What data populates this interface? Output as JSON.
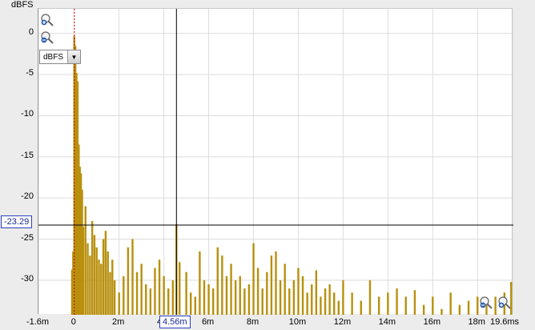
{
  "y_axis": {
    "unit": "dBFS",
    "ticks": [
      "0",
      "-5",
      "-10",
      "-15",
      "-20",
      "-25",
      "-30"
    ]
  },
  "x_axis": {
    "ticks": [
      "-1.6m",
      "0",
      "2m",
      "4m",
      "6m",
      "8m",
      "10m",
      "12m",
      "14m",
      "16m",
      "18m",
      "19.6ms"
    ]
  },
  "cursor": {
    "y_label": "-23.29",
    "x_label": "4.56m"
  },
  "unit_dropdown": {
    "selected": "dBFS"
  },
  "icons": [
    "zoom-in-icon",
    "zoom-out-icon",
    "dropdown-arrow-icon"
  ],
  "colors": {
    "trace": "#b8900e",
    "start_marker": "#d00000",
    "cursor": "#000000",
    "grid": "#dcdcdc"
  },
  "chart_data": {
    "type": "bar",
    "xlabel": "",
    "ylabel": "dBFS",
    "xlim": [
      -1.6,
      19.6
    ],
    "ylim": [
      -34.2,
      3
    ],
    "x_unit": "ms",
    "grid": true,
    "cursor": {
      "x": 4.56,
      "y": -23.29
    },
    "start_marker_x": 0,
    "x": [
      -0.1,
      -0.05,
      0.0,
      0.05,
      0.1,
      0.15,
      0.2,
      0.25,
      0.3,
      0.35,
      0.4,
      0.5,
      0.6,
      0.7,
      0.8,
      0.9,
      1.0,
      1.1,
      1.2,
      1.3,
      1.4,
      1.5,
      1.6,
      1.7,
      1.8,
      2.0,
      2.2,
      2.4,
      2.6,
      2.8,
      3.0,
      3.2,
      3.4,
      3.6,
      3.8,
      4.0,
      4.2,
      4.4,
      4.56,
      4.7,
      5.0,
      5.2,
      5.4,
      5.6,
      5.8,
      6.0,
      6.2,
      6.4,
      6.6,
      6.8,
      7.0,
      7.2,
      7.4,
      7.6,
      7.8,
      8.0,
      8.2,
      8.4,
      8.6,
      8.8,
      9.0,
      9.2,
      9.4,
      9.6,
      9.8,
      10.0,
      10.2,
      10.4,
      10.6,
      10.8,
      11.0,
      11.2,
      11.4,
      11.6,
      11.8,
      12.0,
      12.4,
      12.8,
      13.2,
      13.6,
      14.0,
      14.4,
      14.8,
      15.2,
      15.6,
      16.0,
      16.4,
      16.8,
      17.2,
      17.6,
      18.0,
      18.4,
      18.8,
      19.2,
      19.5
    ],
    "values": [
      -28.7,
      -26.5,
      -0.3,
      -1.5,
      -4.8,
      -5.8,
      -13.5,
      -16.2,
      -17.0,
      -19.0,
      -23.5,
      -21.0,
      -25.5,
      -27.0,
      -22.8,
      -24.5,
      -26.0,
      -27.5,
      -28.0,
      -25.0,
      -24.0,
      -26.5,
      -29.0,
      -27.5,
      -30.0,
      -31.5,
      -29.5,
      -26.0,
      -25.0,
      -29.0,
      -28.0,
      -30.5,
      -31.0,
      -28.5,
      -27.5,
      -29.5,
      -31.0,
      -30.0,
      -23.2,
      -27.8,
      -29.0,
      -31.5,
      -32.0,
      -26.5,
      -30.0,
      -30.5,
      -31.0,
      -26.0,
      -27.0,
      -29.5,
      -28.0,
      -30.0,
      -29.5,
      -31.0,
      -30.5,
      -25.5,
      -28.5,
      -31.0,
      -29.0,
      -27.0,
      -26.5,
      -30.0,
      -28.0,
      -31.0,
      -30.0,
      -28.5,
      -29.5,
      -31.5,
      -30.5,
      -28.8,
      -32.0,
      -31.0,
      -30.5,
      -31.5,
      -32.5,
      -30.0,
      -31.5,
      -32.5,
      -30.0,
      -32.0,
      -31.5,
      -31.0,
      -32.0,
      -31.2,
      -33.0,
      -32.0,
      -33.5,
      -31.5,
      -33.0,
      -32.5,
      -32.0,
      -32.5,
      -32.0,
      -31.5,
      -30.2
    ]
  }
}
